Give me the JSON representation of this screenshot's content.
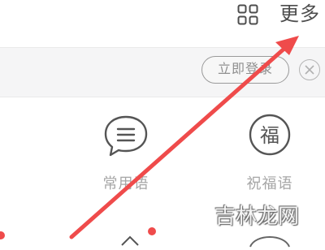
{
  "header": {
    "more_label": "更多",
    "grid_icon": "grid-icon"
  },
  "login_banner": {
    "login_label": "立即登录",
    "close_icon": "close-icon"
  },
  "features": [
    {
      "label": "常用语",
      "icon": "speech-bubble-icon"
    },
    {
      "label": "祝福语",
      "icon": "blessing-icon",
      "icon_text": "福"
    }
  ],
  "overlay": {
    "arrow_color": "#ef4b4b",
    "arrow_icon": "annotation-arrow"
  },
  "watermark": {
    "text": "吉林龙网"
  },
  "colors": {
    "accent": "#ef4b4b",
    "banner_bg": "#f5f5f6",
    "label_gray": "#a6a6a6"
  }
}
